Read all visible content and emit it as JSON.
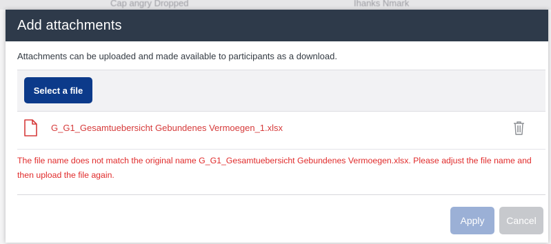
{
  "background": {
    "left_text": "Cap angry Dropped",
    "right_text": "Ihanks Nmark"
  },
  "dialog": {
    "title": "Add attachments",
    "intro": "Attachments can be uploaded and made available to participants as a download.",
    "select_file_label": "Select a file",
    "file": {
      "name": "G_G1_Gesamtuebersicht Gebundenes Vermoegen_1.xlsx",
      "icon": "file-icon",
      "delete_icon": "trash-icon"
    },
    "error": "The file name does not match the original name G_G1_Gesamtuebersicht Gebundenes Vermoegen.xlsx. Please adjust the file name and then upload the file again.",
    "apply_label": "Apply",
    "cancel_label": "Cancel"
  },
  "colors": {
    "header": "#2e3a4a",
    "primary": "#0c3a8a",
    "error": "#e02a2a",
    "apply_disabled": "#9bb0d6",
    "cancel": "#c7c9cd"
  }
}
